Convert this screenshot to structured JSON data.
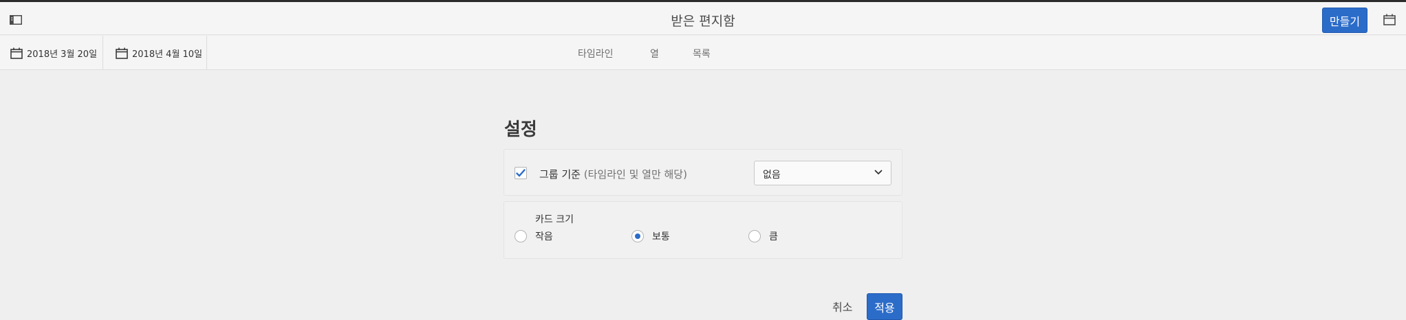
{
  "header": {
    "title": "받은 편지함",
    "create_label": "만들기",
    "icons": [
      "sidebar-toggle-icon",
      "calendar-icon"
    ]
  },
  "toolbar": {
    "start_date": "2018년 3월 20일",
    "end_date": "2018년 4월 10일",
    "views": {
      "timeline": "타임라인",
      "column": "열",
      "list": "목록"
    }
  },
  "settings": {
    "title": "설정",
    "group_by": {
      "checked": true,
      "label": "그룹 기준",
      "hint": "(타임라인 및 열만 해당)",
      "selected": "없음"
    },
    "card_size": {
      "label": "카드 크기",
      "options": {
        "small": "작음",
        "medium": "보통",
        "large": "큼"
      },
      "selected": "보통"
    },
    "cancel_label": "취소",
    "apply_label": "적용"
  },
  "colors": {
    "accent": "#2c6cc9",
    "background": "#efefef"
  }
}
